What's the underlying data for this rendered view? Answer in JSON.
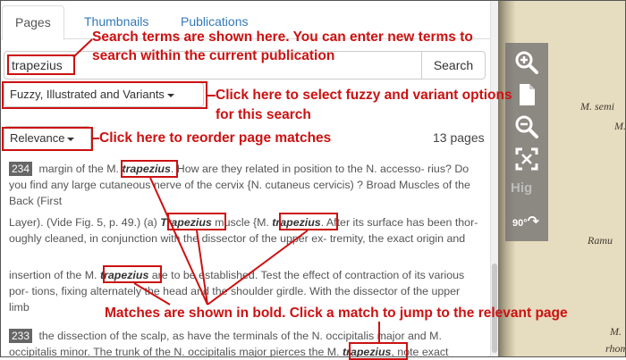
{
  "tabs": [
    "Pages",
    "Thumbnails",
    "Publications"
  ],
  "search": {
    "value": "trapezius",
    "button": "Search"
  },
  "options_dropdown": "Fuzzy, Illustrated and Variants",
  "sort_dropdown": "Relevance",
  "page_count": "13 pages",
  "results": [
    {
      "page": "234",
      "before": " margin of the M. ",
      "match": "trapezius",
      "after": ". How are they related in position to the N. accesso- rius? Do you find any large cutaneous nerve of the cervix {N. cutaneus cervicis) ? Broad Muscles of the Back (First"
    },
    {
      "page": "",
      "before": "Layer). (Vide Fig. 5, p. 49.) (a) ",
      "match": "Trapezius",
      "middle": " muscle {M. ",
      "match2": "trapezius",
      "after": ". After its surface has been thor- oughly cleaned, in conjunction with the dissector of the upper ex- tremity, the exact origin and"
    },
    {
      "page": "",
      "before": "insertion of the M. ",
      "match": "trapezius",
      "after": " are to be established. Test the effect of contraction of its various por- tions, fixing alternately the head and the shoulder girdle. With the dissector of the upper limb"
    },
    {
      "page": "233",
      "before": " the dissection of the scalp, as have the terminals of the N. occipitalis major and M. occipitalis minor. The trunk of the N. occipitalis major pierces the M. ",
      "match": "trapezius",
      "after": ", note exact"
    }
  ],
  "annotations": {
    "search": [
      "Search terms are shown here. You can enter new terms to",
      "search within the current publication"
    ],
    "options": [
      "Click here to select fuzzy and variant options",
      "for this search"
    ],
    "sort": "Click here to reorder page matches",
    "matches": "Matches are shown in bold. Click a match to jump to the relevant page"
  },
  "viewer": {
    "tools": [
      "zoom-in-icon",
      "page-icon",
      "zoom-out-icon",
      "fit-screen-icon",
      "highlight-icon",
      "rotate-90-icon"
    ],
    "highlight_label": "Hig",
    "rotate_label": "90°",
    "plate_text": [
      "M. semi",
      "M.",
      "Ramu",
      "M.",
      "rhombo"
    ]
  },
  "colors": {
    "annotation": "#cc1111",
    "link": "#337ab7",
    "toolbar": "#6e6e6e",
    "paper": "#e6dcbf"
  }
}
